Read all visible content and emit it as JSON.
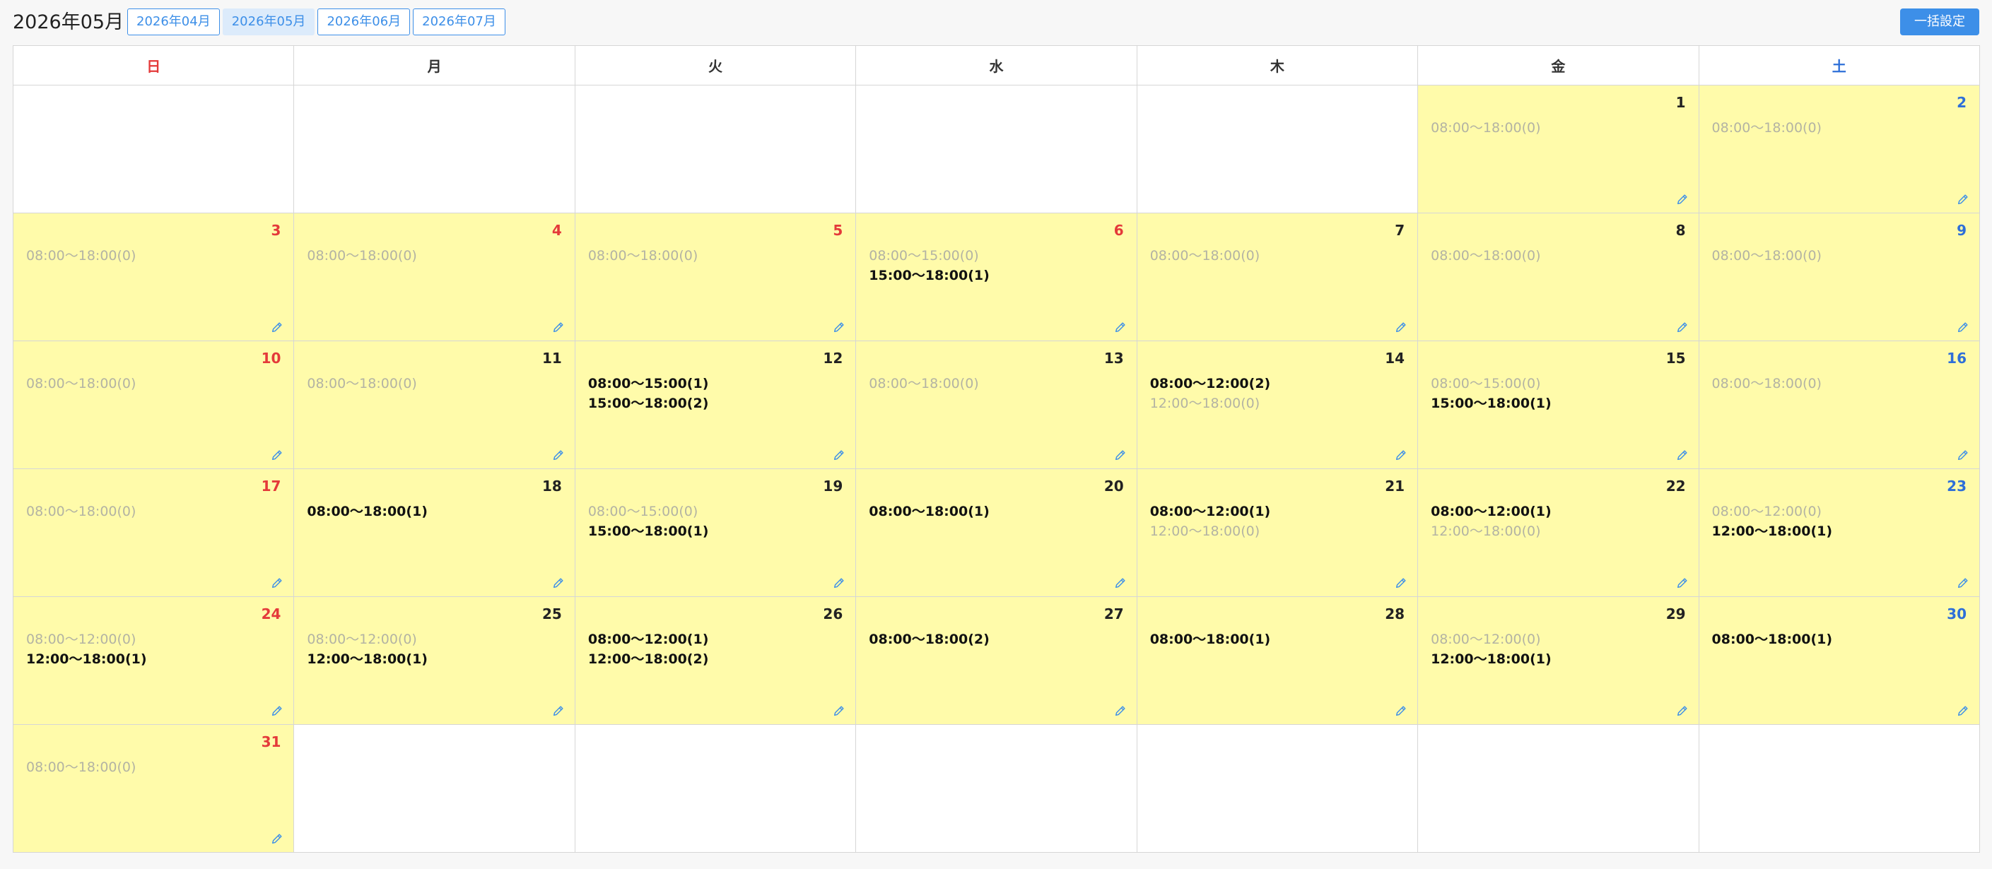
{
  "header": {
    "title": "2026年05月",
    "months": [
      {
        "label": "2026年04月",
        "active": false
      },
      {
        "label": "2026年05月",
        "active": true
      },
      {
        "label": "2026年06月",
        "active": false
      },
      {
        "label": "2026年07月",
        "active": false
      }
    ],
    "bulk_button": "一括設定"
  },
  "weekdays": [
    {
      "label": "日",
      "type": "sun"
    },
    {
      "label": "月",
      "type": ""
    },
    {
      "label": "火",
      "type": ""
    },
    {
      "label": "水",
      "type": ""
    },
    {
      "label": "木",
      "type": ""
    },
    {
      "label": "金",
      "type": ""
    },
    {
      "label": "土",
      "type": "sat"
    }
  ],
  "colors": {
    "accent": "#3d8fe8",
    "day_bg": "#fffbaa",
    "sunday": "#e43a3a",
    "saturday": "#2e6fd8",
    "empty_slot": "#b3b3a3"
  },
  "weeks": [
    [
      null,
      null,
      null,
      null,
      null,
      {
        "day": "1",
        "type": "",
        "slots": [
          {
            "text": "08:00〜18:00(0)",
            "filled": false
          }
        ]
      },
      {
        "day": "2",
        "type": "sat",
        "slots": [
          {
            "text": "08:00〜18:00(0)",
            "filled": false
          }
        ]
      }
    ],
    [
      {
        "day": "3",
        "type": "sun",
        "slots": [
          {
            "text": "08:00〜18:00(0)",
            "filled": false
          }
        ]
      },
      {
        "day": "4",
        "type": "holiday",
        "slots": [
          {
            "text": "08:00〜18:00(0)",
            "filled": false
          }
        ]
      },
      {
        "day": "5",
        "type": "holiday",
        "slots": [
          {
            "text": "08:00〜18:00(0)",
            "filled": false
          }
        ]
      },
      {
        "day": "6",
        "type": "holiday",
        "slots": [
          {
            "text": "08:00〜15:00(0)",
            "filled": false
          },
          {
            "text": "15:00〜18:00(1)",
            "filled": true
          }
        ]
      },
      {
        "day": "7",
        "type": "",
        "slots": [
          {
            "text": "08:00〜18:00(0)",
            "filled": false
          }
        ]
      },
      {
        "day": "8",
        "type": "",
        "slots": [
          {
            "text": "08:00〜18:00(0)",
            "filled": false
          }
        ]
      },
      {
        "day": "9",
        "type": "sat",
        "slots": [
          {
            "text": "08:00〜18:00(0)",
            "filled": false
          }
        ]
      }
    ],
    [
      {
        "day": "10",
        "type": "sun",
        "slots": [
          {
            "text": "08:00〜18:00(0)",
            "filled": false
          }
        ]
      },
      {
        "day": "11",
        "type": "",
        "slots": [
          {
            "text": "08:00〜18:00(0)",
            "filled": false
          }
        ]
      },
      {
        "day": "12",
        "type": "",
        "slots": [
          {
            "text": "08:00〜15:00(1)",
            "filled": true
          },
          {
            "text": "15:00〜18:00(2)",
            "filled": true
          }
        ]
      },
      {
        "day": "13",
        "type": "",
        "slots": [
          {
            "text": "08:00〜18:00(0)",
            "filled": false
          }
        ]
      },
      {
        "day": "14",
        "type": "",
        "slots": [
          {
            "text": "08:00〜12:00(2)",
            "filled": true
          },
          {
            "text": "12:00〜18:00(0)",
            "filled": false
          }
        ]
      },
      {
        "day": "15",
        "type": "",
        "slots": [
          {
            "text": "08:00〜15:00(0)",
            "filled": false
          },
          {
            "text": "15:00〜18:00(1)",
            "filled": true
          }
        ]
      },
      {
        "day": "16",
        "type": "sat",
        "slots": [
          {
            "text": "08:00〜18:00(0)",
            "filled": false
          }
        ]
      }
    ],
    [
      {
        "day": "17",
        "type": "sun",
        "slots": [
          {
            "text": "08:00〜18:00(0)",
            "filled": false
          }
        ]
      },
      {
        "day": "18",
        "type": "",
        "slots": [
          {
            "text": "08:00〜18:00(1)",
            "filled": true
          }
        ]
      },
      {
        "day": "19",
        "type": "",
        "slots": [
          {
            "text": "08:00〜15:00(0)",
            "filled": false
          },
          {
            "text": "15:00〜18:00(1)",
            "filled": true
          }
        ]
      },
      {
        "day": "20",
        "type": "",
        "slots": [
          {
            "text": "08:00〜18:00(1)",
            "filled": true
          }
        ]
      },
      {
        "day": "21",
        "type": "",
        "slots": [
          {
            "text": "08:00〜12:00(1)",
            "filled": true
          },
          {
            "text": "12:00〜18:00(0)",
            "filled": false
          }
        ]
      },
      {
        "day": "22",
        "type": "",
        "slots": [
          {
            "text": "08:00〜12:00(1)",
            "filled": true
          },
          {
            "text": "12:00〜18:00(0)",
            "filled": false
          }
        ]
      },
      {
        "day": "23",
        "type": "sat",
        "slots": [
          {
            "text": "08:00〜12:00(0)",
            "filled": false
          },
          {
            "text": "12:00〜18:00(1)",
            "filled": true
          }
        ]
      }
    ],
    [
      {
        "day": "24",
        "type": "sun",
        "slots": [
          {
            "text": "08:00〜12:00(0)",
            "filled": false
          },
          {
            "text": "12:00〜18:00(1)",
            "filled": true
          }
        ]
      },
      {
        "day": "25",
        "type": "",
        "slots": [
          {
            "text": "08:00〜12:00(0)",
            "filled": false
          },
          {
            "text": "12:00〜18:00(1)",
            "filled": true
          }
        ]
      },
      {
        "day": "26",
        "type": "",
        "slots": [
          {
            "text": "08:00〜12:00(1)",
            "filled": true
          },
          {
            "text": "12:00〜18:00(2)",
            "filled": true
          }
        ]
      },
      {
        "day": "27",
        "type": "",
        "slots": [
          {
            "text": "08:00〜18:00(2)",
            "filled": true
          }
        ]
      },
      {
        "day": "28",
        "type": "",
        "slots": [
          {
            "text": "08:00〜18:00(1)",
            "filled": true
          }
        ]
      },
      {
        "day": "29",
        "type": "",
        "slots": [
          {
            "text": "08:00〜12:00(0)",
            "filled": false
          },
          {
            "text": "12:00〜18:00(1)",
            "filled": true
          }
        ]
      },
      {
        "day": "30",
        "type": "sat",
        "slots": [
          {
            "text": "08:00〜18:00(1)",
            "filled": true
          }
        ]
      }
    ],
    [
      {
        "day": "31",
        "type": "sun",
        "slots": [
          {
            "text": "08:00〜18:00(0)",
            "filled": false
          }
        ]
      },
      null,
      null,
      null,
      null,
      null,
      null
    ]
  ]
}
